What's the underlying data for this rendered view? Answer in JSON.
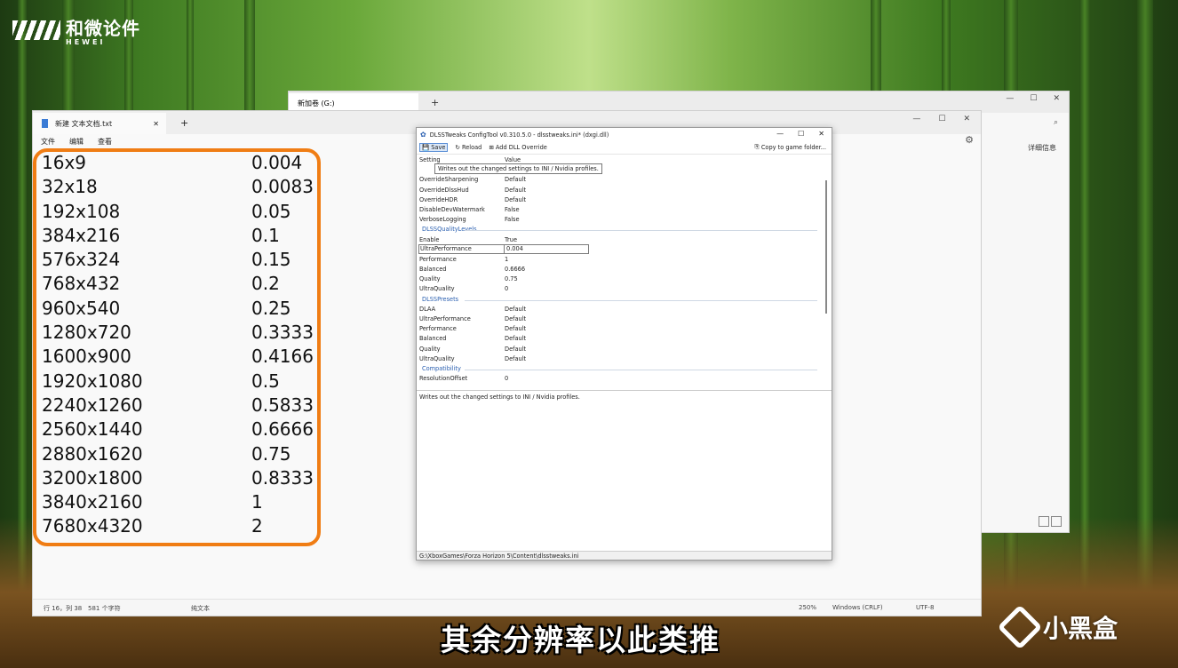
{
  "watermark": {
    "logo_text": "和微论件",
    "logo_sub": "HEWEI"
  },
  "explorer": {
    "tab_label": "新加卷 (G:)",
    "new_tab": "+",
    "min": "—",
    "max": "☐",
    "close": "✕",
    "search_icon": "⌕",
    "details_label": "详细信息"
  },
  "notepad": {
    "tab_label": "新建 文本文档.txt",
    "tab_close": "✕",
    "new_tab": "+",
    "min": "—",
    "max": "☐",
    "close": "✕",
    "menu": [
      "文件",
      "编辑",
      "查看"
    ],
    "settings_icon": "⚙",
    "rows": [
      {
        "res": "16x9",
        "val": "0.004"
      },
      {
        "res": "32x18",
        "val": "0.0083"
      },
      {
        "res": "192x108",
        "val": "0.05"
      },
      {
        "res": "384x216",
        "val": "0.1"
      },
      {
        "res": "576x324",
        "val": "0.15"
      },
      {
        "res": "768x432",
        "val": "0.2"
      },
      {
        "res": "960x540",
        "val": "0.25"
      },
      {
        "res": "1280x720",
        "val": "0.3333"
      },
      {
        "res": "1600x900",
        "val": "0.4166"
      },
      {
        "res": "1920x1080",
        "val": "0.5"
      },
      {
        "res": "2240x1260",
        "val": "0.5833"
      },
      {
        "res": "2560x1440",
        "val": "0.6666"
      },
      {
        "res": "2880x1620",
        "val": "0.75"
      },
      {
        "res": "3200x1800",
        "val": "0.8333"
      },
      {
        "res": "3840x2160",
        "val": "1"
      },
      {
        "res": "7680x4320",
        "val": "2"
      }
    ],
    "status": {
      "position": "行 16，列 38",
      "chars": "581 个字符",
      "format": "纯文本",
      "zoom": "250%",
      "line_ending": "Windows (CRLF)",
      "encoding": "UTF-8"
    }
  },
  "dlss": {
    "title": "DLSSTweaks ConfigTool v0.310.5.0 - dlsstweaks.ini* (dxgi.dll)",
    "min": "—",
    "max": "☐",
    "close": "✕",
    "toolbar": {
      "save": "Save",
      "reload": "Reload",
      "add_dll": "Add DLL Override",
      "copy": "Copy to game folder..."
    },
    "tooltip": "Writes out the changed settings to INI / Nvidia profiles.",
    "header": {
      "setting": "Setting",
      "value": "Value"
    },
    "rows_a": [
      {
        "k": "OverrideSharpening",
        "v": "Default"
      },
      {
        "k": "OverrideDlssHud",
        "v": "Default"
      },
      {
        "k": "OverrideHDR",
        "v": "Default"
      },
      {
        "k": "DisableDevWatermark",
        "v": "False"
      },
      {
        "k": "VerboseLogging",
        "v": "False"
      }
    ],
    "cat_quality": "DLSSQualityLevels",
    "rows_b": [
      {
        "k": "Enable",
        "v": "True"
      },
      {
        "k": "UltraPerformance",
        "v": "0.004"
      },
      {
        "k": "Performance",
        "v": "1"
      },
      {
        "k": "Balanced",
        "v": "0.6666"
      },
      {
        "k": "Quality",
        "v": "0.75"
      },
      {
        "k": "UltraQuality",
        "v": "0"
      }
    ],
    "cat_presets": "DLSSPresets",
    "rows_c": [
      {
        "k": "DLAA",
        "v": "Default"
      },
      {
        "k": "UltraPerformance",
        "v": "Default"
      },
      {
        "k": "Performance",
        "v": "Default"
      },
      {
        "k": "Balanced",
        "v": "Default"
      },
      {
        "k": "Quality",
        "v": "Default"
      },
      {
        "k": "UltraQuality",
        "v": "Default"
      }
    ],
    "cat_compat": "Compatibility",
    "rows_d": [
      {
        "k": "ResolutionOffset",
        "v": "0"
      }
    ],
    "description": "Writes out the changed settings to INI / Nvidia profiles.",
    "path": "G:\\XboxGames\\Forza Horizon 5\\Content\\dlsstweaks.ini"
  },
  "caption": "其余分辨率以此类推",
  "brand": "小黑盒",
  "colors": {
    "highlight": "#f07d14",
    "accent": "#2a5fb0"
  }
}
